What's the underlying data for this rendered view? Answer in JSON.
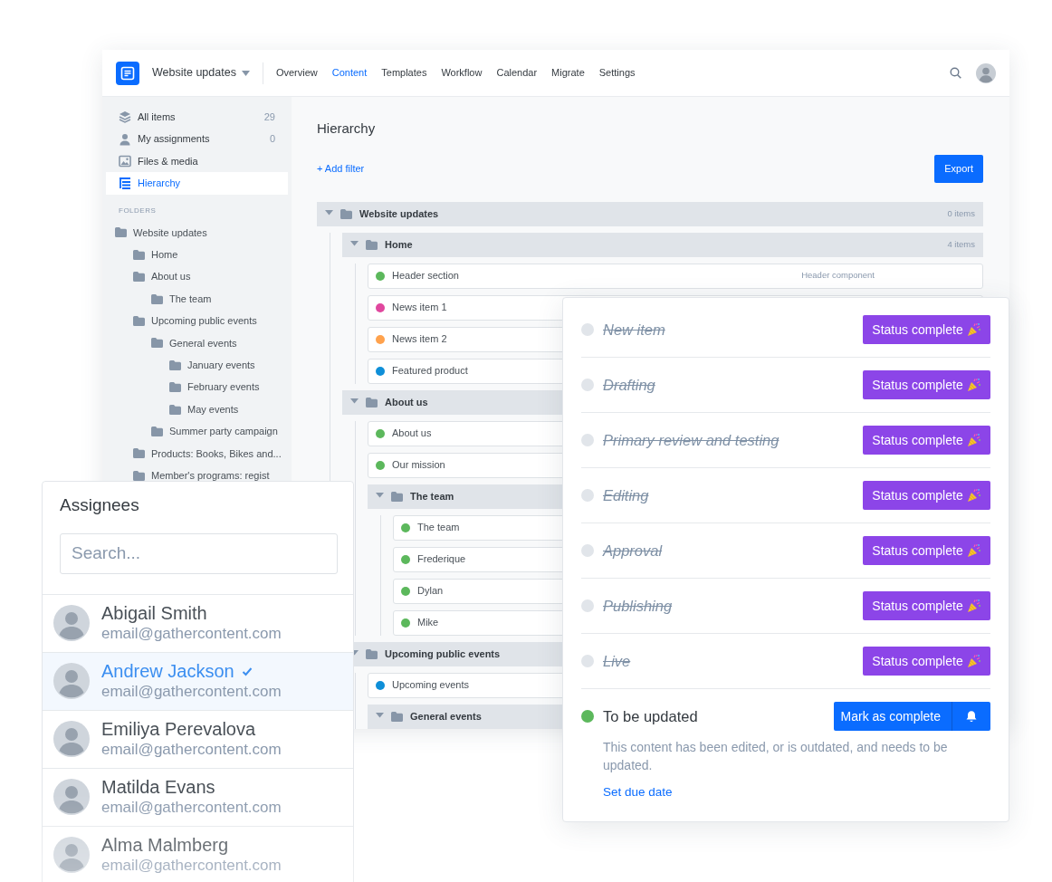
{
  "header": {
    "project": "Website updates",
    "nav": [
      {
        "label": "Overview",
        "selected": false
      },
      {
        "label": "Content",
        "selected": true
      },
      {
        "label": "Templates",
        "selected": false
      },
      {
        "label": "Workflow",
        "selected": false
      },
      {
        "label": "Calendar",
        "selected": false
      },
      {
        "label": "Migrate",
        "selected": false
      },
      {
        "label": "Settings",
        "selected": false
      }
    ]
  },
  "sidebar": {
    "items": [
      {
        "label": "All items",
        "count": "29",
        "selected": false
      },
      {
        "label": "My assignments",
        "count": "0",
        "selected": false
      },
      {
        "label": "Files & media",
        "selected": false
      },
      {
        "label": "Hierarchy",
        "selected": true
      }
    ],
    "folders_heading": "FOLDERS",
    "folders": [
      {
        "label": "Website updates",
        "children": [
          {
            "label": "Home"
          },
          {
            "label": "About us",
            "children": [
              {
                "label": "The team"
              }
            ]
          },
          {
            "label": "Upcoming public events",
            "children": [
              {
                "label": "General events",
                "children": [
                  {
                    "label": "January events"
                  },
                  {
                    "label": "February events"
                  },
                  {
                    "label": "May events"
                  }
                ]
              },
              {
                "label": "Summer party campaign"
              }
            ]
          },
          {
            "label": "Products: Books, Bikes and..."
          },
          {
            "label": "Member's programs: regist"
          }
        ]
      }
    ]
  },
  "hierarchy": {
    "title": "Hierarchy",
    "add_filter": "+ Add filter",
    "export": "Export",
    "tree": [
      {
        "kind": "folder",
        "label": "Website updates",
        "count": "0 items",
        "expanded": true,
        "children": [
          {
            "kind": "folder",
            "label": "Home",
            "count": "4 items",
            "expanded": true,
            "children": [
              {
                "kind": "item",
                "label": "Header section",
                "color": "#5cb85c",
                "note": "Header component"
              },
              {
                "kind": "item",
                "label": "News item 1",
                "color": "#e0479e"
              },
              {
                "kind": "item",
                "label": "News item 2",
                "color": "#ffa24d"
              },
              {
                "kind": "item",
                "label": "Featured product",
                "color": "#0f8fd8"
              }
            ]
          },
          {
            "kind": "folder",
            "label": "About us",
            "expanded": true,
            "children": [
              {
                "kind": "item",
                "label": "About us",
                "color": "#5cb85c"
              },
              {
                "kind": "item",
                "label": "Our mission",
                "color": "#5cb85c"
              },
              {
                "kind": "folder",
                "label": "The team",
                "expanded": true,
                "children": [
                  {
                    "kind": "item",
                    "label": "The team",
                    "color": "#5cb85c"
                  },
                  {
                    "kind": "item",
                    "label": "Frederique",
                    "color": "#5cb85c"
                  },
                  {
                    "kind": "item",
                    "label": "Dylan",
                    "color": "#5cb85c"
                  },
                  {
                    "kind": "item",
                    "label": "Mike",
                    "color": "#5cb85c"
                  }
                ]
              }
            ]
          },
          {
            "kind": "folder",
            "label": "Upcoming public events",
            "expanded": true,
            "children": [
              {
                "kind": "item",
                "label": "Upcoming events",
                "color": "#0f8fd8"
              },
              {
                "kind": "folder",
                "label": "General events",
                "expanded": true
              }
            ]
          }
        ]
      }
    ]
  },
  "statuses": [
    {
      "label": "New item",
      "done": true,
      "action": "Status complete"
    },
    {
      "label": "Drafting",
      "done": true,
      "action": "Status complete"
    },
    {
      "label": "Primary review and testing",
      "done": true,
      "action": "Status complete"
    },
    {
      "label": "Editing",
      "done": true,
      "action": "Status complete"
    },
    {
      "label": "Approval",
      "done": true,
      "action": "Status complete"
    },
    {
      "label": "Publishing",
      "done": true,
      "action": "Status complete"
    },
    {
      "label": "Live",
      "done": true,
      "action": "Status complete"
    },
    {
      "label": "To be updated",
      "done": false,
      "action": "Mark as complete",
      "description": "This content has been edited, or is outdated, and needs to be updated.",
      "link": "Set due date"
    }
  ],
  "assignees": {
    "title": "Assignees",
    "search": {
      "placeholder": "Search..."
    },
    "people": [
      {
        "name": "Abigail Smith",
        "email": "email@gathercontent.com",
        "selected": false
      },
      {
        "name": "Andrew Jackson",
        "email": "email@gathercontent.com",
        "selected": true
      },
      {
        "name": "Emiliya Perevalova",
        "email": "email@gathercontent.com",
        "selected": false
      },
      {
        "name": "Matilda Evans",
        "email": "email@gathercontent.com",
        "selected": false
      },
      {
        "name": "Alma Malmberg",
        "email": "email@gathercontent.com",
        "selected": false
      }
    ]
  }
}
